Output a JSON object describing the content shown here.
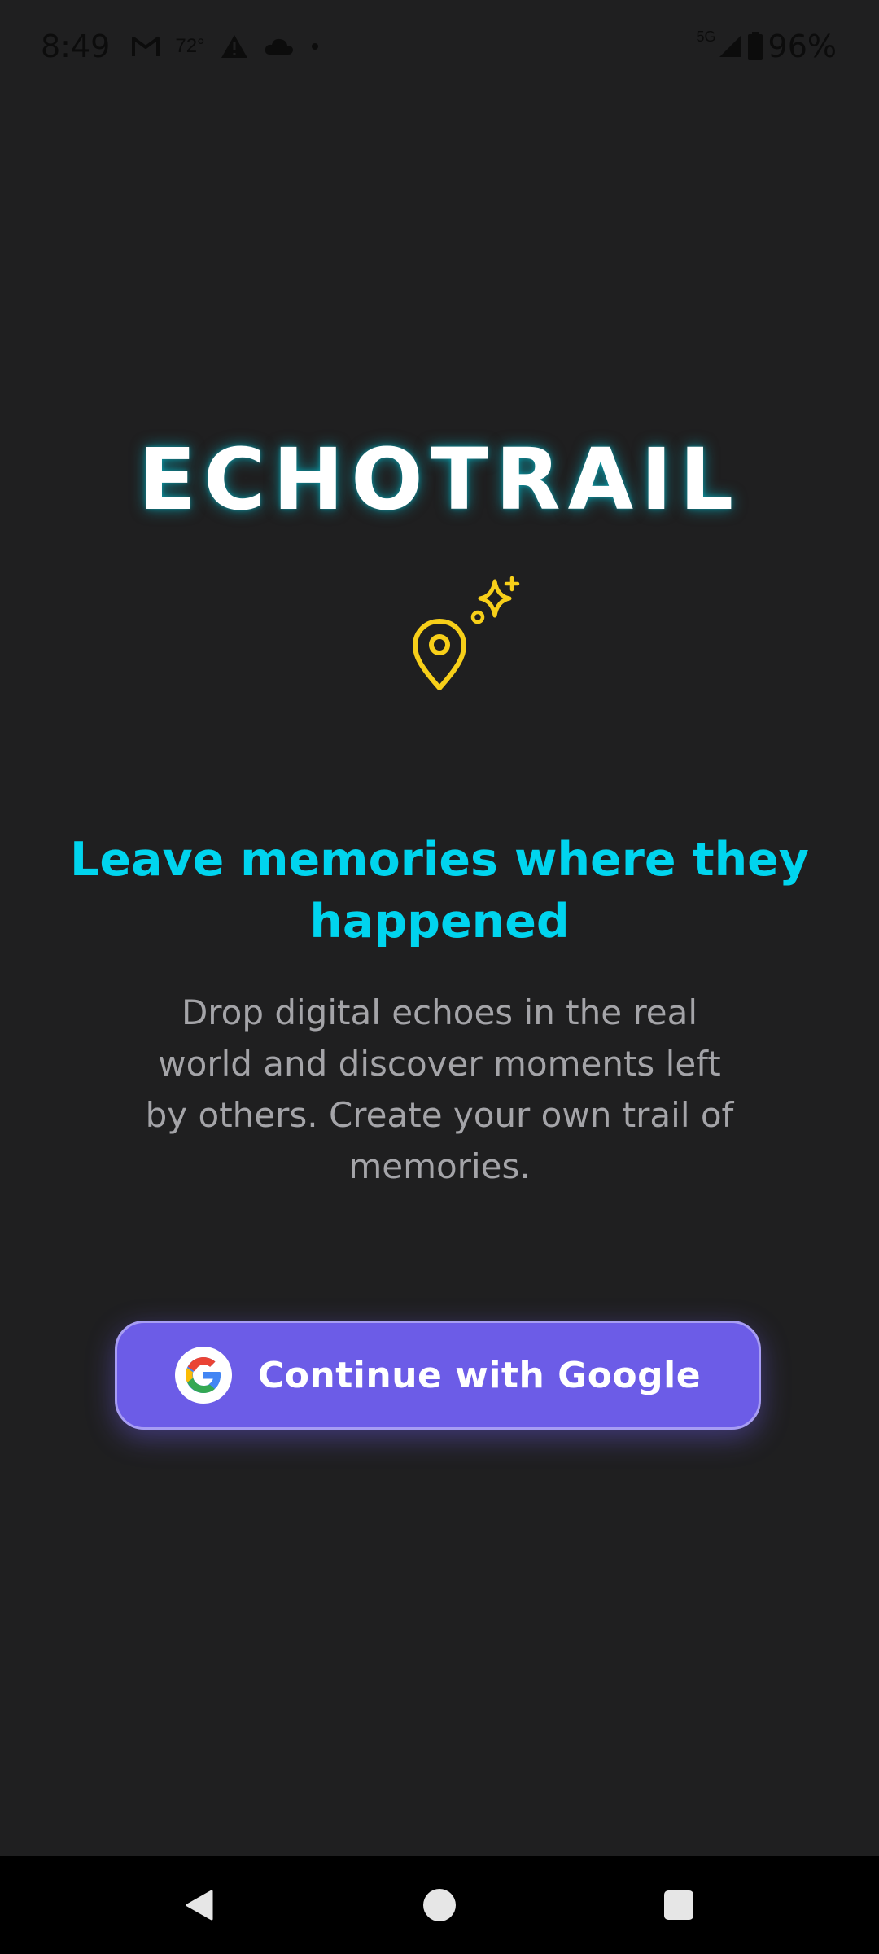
{
  "status_bar": {
    "time": "8:49",
    "temperature": "72°",
    "network": "5G",
    "battery": "96%",
    "icons": [
      "gmail-icon",
      "alert-icon",
      "cloud-icon",
      "dot-icon",
      "signal-icon",
      "battery-icon"
    ]
  },
  "app": {
    "brand": "ECHOTRAIL",
    "hero_icon": "location-pin-sparkle-icon",
    "headline": "Leave memories where they happened",
    "description": "Drop digital echoes in the real world and discover moments left by others. Create your own trail of memories.",
    "google_button_label": "Continue with Google"
  },
  "colors": {
    "background": "#1f1f20",
    "accent_cyan": "#00d4ee",
    "accent_yellow": "#f7cf19",
    "button_purple": "#6c5ce7",
    "text_muted": "#a4a4a8"
  },
  "nav_bar": {
    "icons": [
      "back-icon",
      "home-icon",
      "recents-icon"
    ]
  }
}
